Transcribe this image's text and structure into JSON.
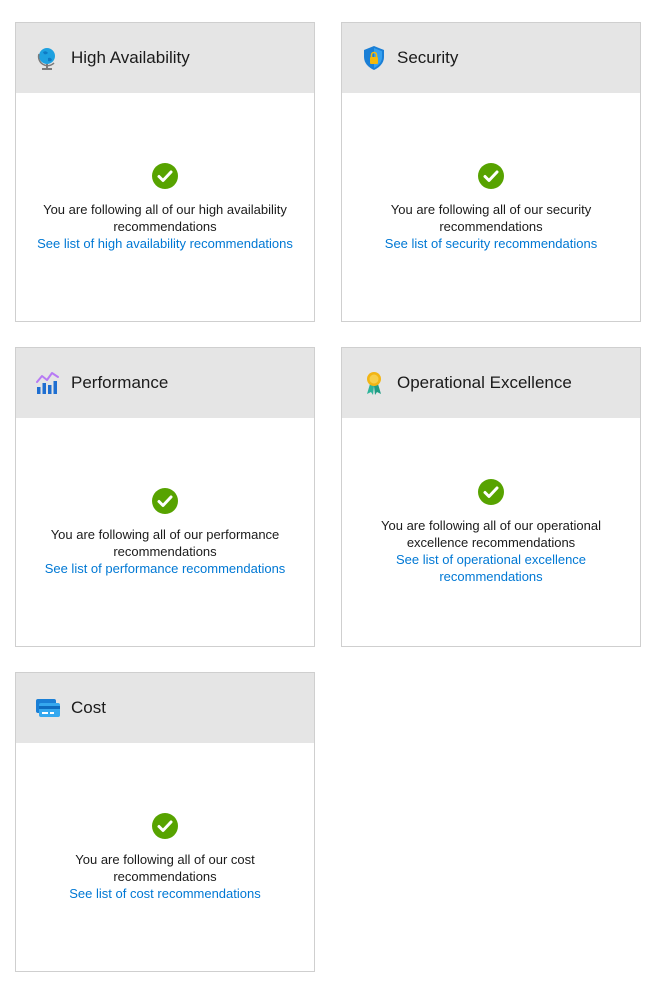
{
  "cards": [
    {
      "title": "High Availability",
      "icon": "globe-icon",
      "message": "You are following all of our high availability recommendations",
      "link": "See list of high availability recommendations"
    },
    {
      "title": "Security",
      "icon": "shield-lock-icon",
      "message": "You are following all of our security recommendations",
      "link": "See list of security recommendations"
    },
    {
      "title": "Performance",
      "icon": "performance-chart-icon",
      "message": "You are following all of our performance recommendations",
      "link": "See list of performance recommendations"
    },
    {
      "title": "Operational Excellence",
      "icon": "award-ribbon-icon",
      "message": "You are following all of our operational excellence recommendations",
      "link": "See list of operational excellence recommendations"
    },
    {
      "title": "Cost",
      "icon": "credit-card-icon",
      "message": "You are following all of our cost recommendations",
      "link": "See list of cost recommendations"
    }
  ],
  "colors": {
    "success": "#57a300",
    "link": "#0078d4",
    "header_bg": "#e5e5e5"
  }
}
